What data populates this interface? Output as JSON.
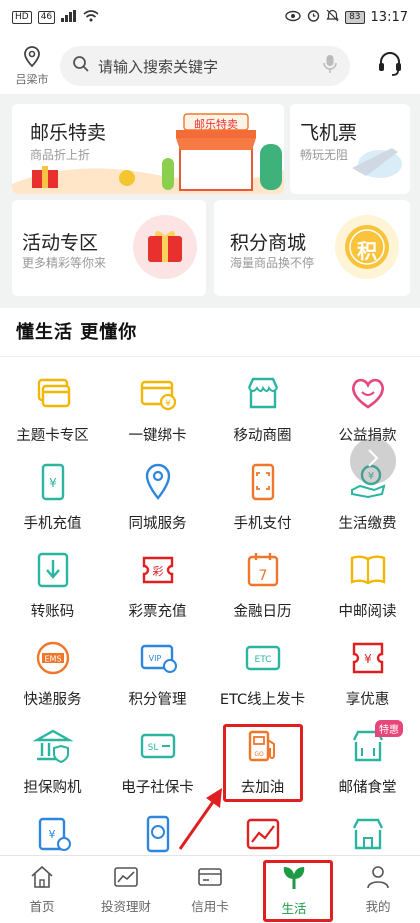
{
  "status_bar": {
    "left_chip1": "HD",
    "left_chip2": "46",
    "battery": "83",
    "time": "13:17"
  },
  "header": {
    "location": "吕梁市",
    "search_placeholder": "请输入搜索关键字"
  },
  "cards": {
    "youle": {
      "title": "邮乐特卖",
      "sub": "商品折上折",
      "store_sign": "邮乐特卖"
    },
    "flight": {
      "title": "飞机票",
      "sub": "畅玩无阻"
    },
    "activity": {
      "title": "活动专区",
      "sub": "更多精彩等你来"
    },
    "points": {
      "title": "积分商城",
      "sub": "海量商品换不停",
      "badge": "积"
    }
  },
  "section": {
    "title": "懂生活  更懂你"
  },
  "grid": [
    {
      "label": "主题卡专区",
      "icon": "card-stack-icon",
      "color": "#f2b705"
    },
    {
      "label": "一键绑卡",
      "icon": "card-bind-icon",
      "color": "#f2b705"
    },
    {
      "label": "移动商圈",
      "icon": "shop-icon",
      "color": "#2bb5a0"
    },
    {
      "label": "公益捐款",
      "icon": "heart-icon",
      "color": "#e8457a"
    },
    {
      "label": "手机充值",
      "icon": "phone-yen-icon",
      "color": "#2bb5a0"
    },
    {
      "label": "同城服务",
      "icon": "location-pin-icon",
      "color": "#2e86de"
    },
    {
      "label": "手机支付",
      "icon": "phone-scan-icon",
      "color": "#f0762a"
    },
    {
      "label": "生活缴费",
      "icon": "hand-yen-icon",
      "color": "#2bb5a0"
    },
    {
      "label": "转账码",
      "icon": "transfer-icon",
      "color": "#2bb5a0"
    },
    {
      "label": "彩票充值",
      "icon": "lottery-icon",
      "color": "#e02020"
    },
    {
      "label": "金融日历",
      "icon": "calendar-icon",
      "color": "#f0762a"
    },
    {
      "label": "中邮阅读",
      "icon": "book-icon",
      "color": "#f2b705"
    },
    {
      "label": "快递服务",
      "icon": "ems-icon",
      "color": "#f0762a"
    },
    {
      "label": "积分管理",
      "icon": "vip-card-icon",
      "color": "#2e86de"
    },
    {
      "label": "ETC线上发卡",
      "icon": "etc-icon",
      "color": "#2bb5a0"
    },
    {
      "label": "享优惠",
      "icon": "coupon-icon",
      "color": "#e02020"
    },
    {
      "label": "担保购机",
      "icon": "bank-shield-icon",
      "color": "#2bb5a0"
    },
    {
      "label": "电子社保卡",
      "icon": "sl-card-icon",
      "color": "#2bb5a0"
    },
    {
      "label": "去加油",
      "icon": "fuel-pump-icon",
      "color": "#f0762a"
    },
    {
      "label": "邮储食堂",
      "icon": "canteen-icon",
      "color": "#2bb5a0",
      "badge": "特惠"
    },
    {
      "label": "",
      "icon": "tax-icon",
      "color": "#2e86de"
    },
    {
      "label": "",
      "icon": "phone-card-icon",
      "color": "#2e86de"
    },
    {
      "label": "",
      "icon": "chart-icon",
      "color": "#e02020"
    },
    {
      "label": "",
      "icon": "store-icon",
      "color": "#2bb5a0"
    }
  ],
  "tabs": [
    {
      "label": "首页",
      "icon": "home-icon"
    },
    {
      "label": "投资理财",
      "icon": "investment-icon"
    },
    {
      "label": "信用卡",
      "icon": "credit-card-icon"
    },
    {
      "label": "生活",
      "icon": "sprout-icon"
    },
    {
      "label": "我的",
      "icon": "user-icon"
    }
  ],
  "colors": {
    "accent": "#1e9a46",
    "highlight": "#e02020"
  }
}
